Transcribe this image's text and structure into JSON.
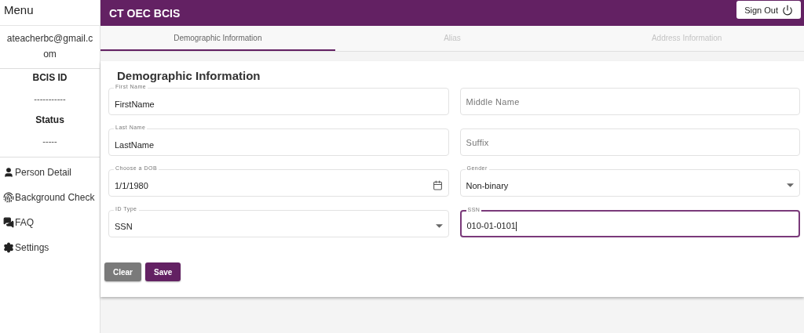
{
  "sidebar": {
    "title": "Menu",
    "email": "ateacherbc@gmail.com",
    "info": [
      {
        "label": "BCIS ID",
        "value": "-----------"
      },
      {
        "label": "Status",
        "value": "-----"
      }
    ],
    "items": [
      {
        "label": "Person Detail",
        "kind": "person"
      },
      {
        "label": "Background Check",
        "kind": "fingerprint"
      },
      {
        "label": "FAQ",
        "kind": "forum"
      },
      {
        "label": "Settings",
        "kind": "settings"
      }
    ]
  },
  "header": {
    "title": "CT OEC BCIS",
    "sign_out": "Sign Out"
  },
  "tabs": [
    {
      "label": "Demographic Information",
      "selected": true
    },
    {
      "label": "Alias",
      "selected": false
    },
    {
      "label": "Address Information",
      "selected": false
    }
  ],
  "form": {
    "title": "Demographic Information",
    "fields": [
      {
        "kind": "text",
        "label": "First Name",
        "value": "FirstName",
        "focused": false
      },
      {
        "kind": "text",
        "placeholder": "Middle Name",
        "focused": false
      },
      {
        "kind": "text",
        "label": "Last Name",
        "value": "LastName",
        "focused": false
      },
      {
        "kind": "text",
        "placeholder": "Suffix",
        "focused": false
      },
      {
        "kind": "date",
        "label": "Choose a DOB",
        "value": "1/1/1980",
        "focused": false
      },
      {
        "kind": "select",
        "label": "Gender",
        "value": "Non-binary",
        "focused": false
      },
      {
        "kind": "select",
        "label": "ID Type",
        "value": "SSN",
        "focused": false
      },
      {
        "kind": "text",
        "label": "SSN",
        "value": "010-01-0101",
        "focused": true
      }
    ],
    "buttons": [
      {
        "label": "Clear",
        "kind": "secondary"
      },
      {
        "label": "Save",
        "kind": "primary"
      }
    ]
  }
}
